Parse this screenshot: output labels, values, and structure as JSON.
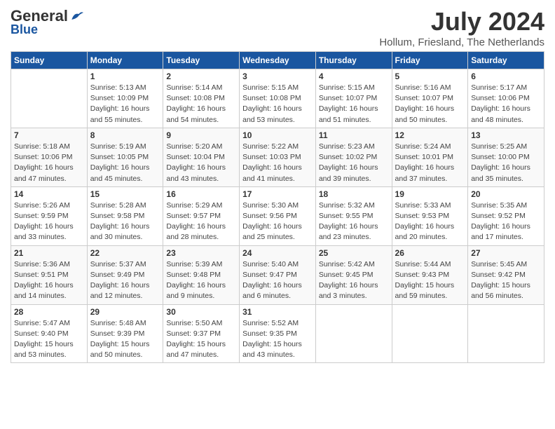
{
  "header": {
    "logo_general": "General",
    "logo_blue": "Blue",
    "month": "July 2024",
    "location": "Hollum, Friesland, The Netherlands"
  },
  "days_of_week": [
    "Sunday",
    "Monday",
    "Tuesday",
    "Wednesday",
    "Thursday",
    "Friday",
    "Saturday"
  ],
  "weeks": [
    [
      {
        "day": "",
        "sunrise": "",
        "sunset": "",
        "daylight": ""
      },
      {
        "day": "1",
        "sunrise": "5:13 AM",
        "sunset": "10:09 PM",
        "daylight": "16 hours and 55 minutes."
      },
      {
        "day": "2",
        "sunrise": "5:14 AM",
        "sunset": "10:08 PM",
        "daylight": "16 hours and 54 minutes."
      },
      {
        "day": "3",
        "sunrise": "5:15 AM",
        "sunset": "10:08 PM",
        "daylight": "16 hours and 53 minutes."
      },
      {
        "day": "4",
        "sunrise": "5:15 AM",
        "sunset": "10:07 PM",
        "daylight": "16 hours and 51 minutes."
      },
      {
        "day": "5",
        "sunrise": "5:16 AM",
        "sunset": "10:07 PM",
        "daylight": "16 hours and 50 minutes."
      },
      {
        "day": "6",
        "sunrise": "5:17 AM",
        "sunset": "10:06 PM",
        "daylight": "16 hours and 48 minutes."
      }
    ],
    [
      {
        "day": "7",
        "sunrise": "5:18 AM",
        "sunset": "10:06 PM",
        "daylight": "16 hours and 47 minutes."
      },
      {
        "day": "8",
        "sunrise": "5:19 AM",
        "sunset": "10:05 PM",
        "daylight": "16 hours and 45 minutes."
      },
      {
        "day": "9",
        "sunrise": "5:20 AM",
        "sunset": "10:04 PM",
        "daylight": "16 hours and 43 minutes."
      },
      {
        "day": "10",
        "sunrise": "5:22 AM",
        "sunset": "10:03 PM",
        "daylight": "16 hours and 41 minutes."
      },
      {
        "day": "11",
        "sunrise": "5:23 AM",
        "sunset": "10:02 PM",
        "daylight": "16 hours and 39 minutes."
      },
      {
        "day": "12",
        "sunrise": "5:24 AM",
        "sunset": "10:01 PM",
        "daylight": "16 hours and 37 minutes."
      },
      {
        "day": "13",
        "sunrise": "5:25 AM",
        "sunset": "10:00 PM",
        "daylight": "16 hours and 35 minutes."
      }
    ],
    [
      {
        "day": "14",
        "sunrise": "5:26 AM",
        "sunset": "9:59 PM",
        "daylight": "16 hours and 33 minutes."
      },
      {
        "day": "15",
        "sunrise": "5:28 AM",
        "sunset": "9:58 PM",
        "daylight": "16 hours and 30 minutes."
      },
      {
        "day": "16",
        "sunrise": "5:29 AM",
        "sunset": "9:57 PM",
        "daylight": "16 hours and 28 minutes."
      },
      {
        "day": "17",
        "sunrise": "5:30 AM",
        "sunset": "9:56 PM",
        "daylight": "16 hours and 25 minutes."
      },
      {
        "day": "18",
        "sunrise": "5:32 AM",
        "sunset": "9:55 PM",
        "daylight": "16 hours and 23 minutes."
      },
      {
        "day": "19",
        "sunrise": "5:33 AM",
        "sunset": "9:53 PM",
        "daylight": "16 hours and 20 minutes."
      },
      {
        "day": "20",
        "sunrise": "5:35 AM",
        "sunset": "9:52 PM",
        "daylight": "16 hours and 17 minutes."
      }
    ],
    [
      {
        "day": "21",
        "sunrise": "5:36 AM",
        "sunset": "9:51 PM",
        "daylight": "16 hours and 14 minutes."
      },
      {
        "day": "22",
        "sunrise": "5:37 AM",
        "sunset": "9:49 PM",
        "daylight": "16 hours and 12 minutes."
      },
      {
        "day": "23",
        "sunrise": "5:39 AM",
        "sunset": "9:48 PM",
        "daylight": "16 hours and 9 minutes."
      },
      {
        "day": "24",
        "sunrise": "5:40 AM",
        "sunset": "9:47 PM",
        "daylight": "16 hours and 6 minutes."
      },
      {
        "day": "25",
        "sunrise": "5:42 AM",
        "sunset": "9:45 PM",
        "daylight": "16 hours and 3 minutes."
      },
      {
        "day": "26",
        "sunrise": "5:44 AM",
        "sunset": "9:43 PM",
        "daylight": "15 hours and 59 minutes."
      },
      {
        "day": "27",
        "sunrise": "5:45 AM",
        "sunset": "9:42 PM",
        "daylight": "15 hours and 56 minutes."
      }
    ],
    [
      {
        "day": "28",
        "sunrise": "5:47 AM",
        "sunset": "9:40 PM",
        "daylight": "15 hours and 53 minutes."
      },
      {
        "day": "29",
        "sunrise": "5:48 AM",
        "sunset": "9:39 PM",
        "daylight": "15 hours and 50 minutes."
      },
      {
        "day": "30",
        "sunrise": "5:50 AM",
        "sunset": "9:37 PM",
        "daylight": "15 hours and 47 minutes."
      },
      {
        "day": "31",
        "sunrise": "5:52 AM",
        "sunset": "9:35 PM",
        "daylight": "15 hours and 43 minutes."
      },
      {
        "day": "",
        "sunrise": "",
        "sunset": "",
        "daylight": ""
      },
      {
        "day": "",
        "sunrise": "",
        "sunset": "",
        "daylight": ""
      },
      {
        "day": "",
        "sunrise": "",
        "sunset": "",
        "daylight": ""
      }
    ]
  ]
}
